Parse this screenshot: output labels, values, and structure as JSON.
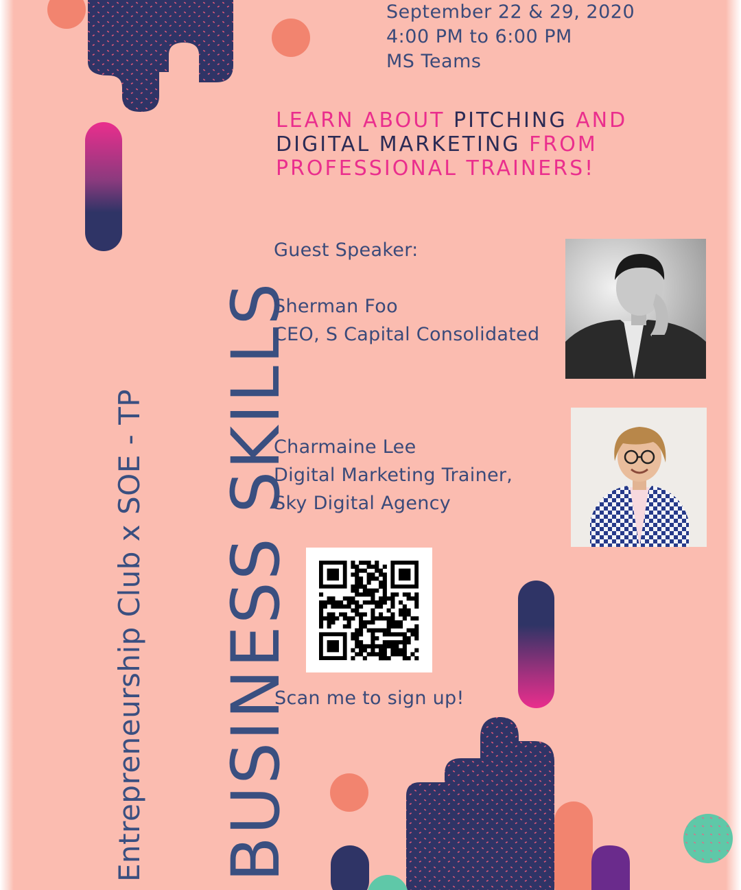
{
  "event": {
    "dates": "September 22 & 29, 2020",
    "time": "4:00 PM to 6:00 PM",
    "venue": "MS Teams"
  },
  "headline": {
    "line1_a": "LEARN ABOUT ",
    "line1_b": "PITCHING",
    "line1_c": " AND",
    "line2_a": "DIGITAL MARKETING",
    "line2_b": " FROM",
    "line3": "PROFESSIONAL  TRAINERS!"
  },
  "title": "BUSINESS SKILLS",
  "subtitle": "Entrepreneurship Club x SOE - TP",
  "guest_label": "Guest Speaker:",
  "speakers": [
    {
      "name": "Sherman Foo",
      "role": "CEO, S Capital Consolidated"
    },
    {
      "name": "Charmaine Lee",
      "role": "Digital Marketing Trainer,",
      "org": "Sky Digital Agency"
    }
  ],
  "signup_text": "Scan me to sign up!",
  "colors": {
    "background": "#fbbcb0",
    "navy": "#2f3466",
    "pink": "#ea2e8d",
    "coral": "#f2846f",
    "teal": "#5fc8a8",
    "purple": "#6a2b8c",
    "text": "#3a4a7a"
  },
  "icons": {
    "qr": "qr-code-icon"
  }
}
